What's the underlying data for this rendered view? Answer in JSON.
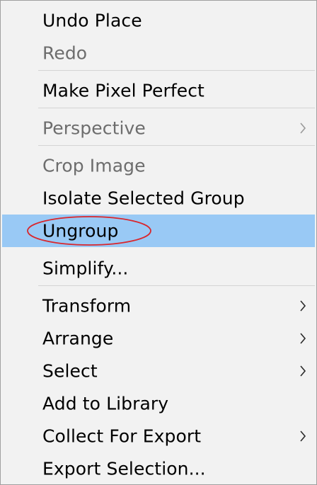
{
  "menu": {
    "items": [
      {
        "label": "Undo Place",
        "enabled": true
      },
      {
        "label": "Redo",
        "enabled": false
      },
      {
        "label": "Make Pixel Perfect",
        "enabled": true
      },
      {
        "label": "Perspective",
        "enabled": false,
        "submenu": true
      },
      {
        "label": "Crop Image",
        "enabled": false
      },
      {
        "label": "Isolate Selected Group",
        "enabled": true
      },
      {
        "label": "Ungroup",
        "enabled": true,
        "highlighted": true
      },
      {
        "label": "Simplify...",
        "enabled": true
      },
      {
        "label": "Transform",
        "enabled": true,
        "submenu": true
      },
      {
        "label": "Arrange",
        "enabled": true,
        "submenu": true
      },
      {
        "label": "Select",
        "enabled": true,
        "submenu": true
      },
      {
        "label": "Add to Library",
        "enabled": true
      },
      {
        "label": "Collect For Export",
        "enabled": true,
        "submenu": true
      },
      {
        "label": "Export Selection...",
        "enabled": true
      }
    ]
  },
  "colors": {
    "menu_background": "#f2f2f2",
    "highlight": "#99c9f5",
    "disabled_text": "#6d6d6d",
    "annotation_ellipse": "#d9262c"
  },
  "icons": {
    "submenu_arrow": "chevron-right-icon"
  }
}
